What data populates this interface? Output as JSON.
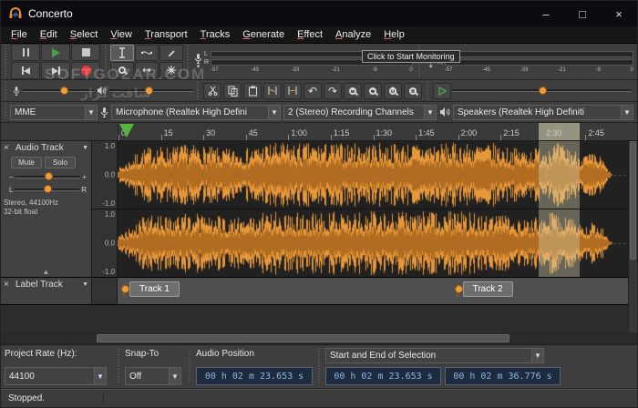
{
  "window": {
    "title": "Concerto",
    "minimize": "–",
    "maximize": "□",
    "close": "×"
  },
  "watermark": {
    "line1": "SOFTGOZAR.COM",
    "line2": "سافت گزار"
  },
  "menu": {
    "items": [
      "File",
      "Edit",
      "Select",
      "View",
      "Transport",
      "Tracks",
      "Generate",
      "Effect",
      "Analyze",
      "Help"
    ]
  },
  "meters": {
    "l": "L",
    "r": "R",
    "tooltip": "Click to Start Monitoring",
    "scale": [
      "-57",
      "-45",
      "-33",
      "-21",
      "-9",
      "0"
    ]
  },
  "devices": {
    "host": "MME",
    "recording": "Microphone (Realtek High Defini",
    "channels": "2 (Stereo) Recording Channels",
    "playback": "Speakers (Realtek High Definiti"
  },
  "timeline": {
    "ticks": [
      "0",
      "15",
      "30",
      "45",
      "1:00",
      "1:15",
      "1:30",
      "1:45",
      "2:00",
      "2:15",
      "2:30",
      "2:45"
    ]
  },
  "audio_track": {
    "close": "×",
    "menu": "▼",
    "name": "Audio Track",
    "mute": "Mute",
    "solo": "Solo",
    "gain_min": "−",
    "gain_plus": "+",
    "pan_left": "L",
    "pan_right": "R",
    "info1": "Stereo, 44100Hz",
    "info2": "32-bit float",
    "collapse": "▲",
    "scale_top": "1.0",
    "scale_mid": "0.0",
    "scale_bot": "-1.0"
  },
  "label_track": {
    "close": "×",
    "menu": "▼",
    "name": "Label Track",
    "labels": [
      "Track 1",
      "Track 2"
    ]
  },
  "bottom": {
    "project_rate_label": "Project Rate (Hz):",
    "project_rate": "44100",
    "snap_label": "Snap-To",
    "snap": "Off",
    "audio_position_label": "Audio Position",
    "audio_position": "00 h 02 m 23.653 s",
    "selection_mode": "Start and End of Selection",
    "selection_start": "00 h 02 m 23.653 s",
    "selection_end": "00 h 02 m 36.776 s"
  },
  "status": {
    "text": "Stopped."
  }
}
